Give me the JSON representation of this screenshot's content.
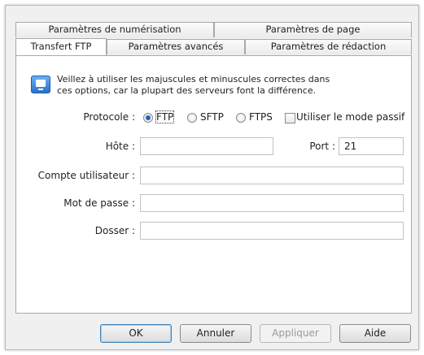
{
  "tabs": {
    "row1": [
      "Paramètres de numérisation",
      "Paramètres de page"
    ],
    "row2": [
      "Transfert FTP",
      "Paramètres avancés",
      "Paramètres de rédaction"
    ]
  },
  "info": {
    "line1": "Veillez à utiliser les majuscules et minuscules correctes dans",
    "line2": "ces options, car la plupart des serveurs font la différence."
  },
  "protocol": {
    "label": "Protocole :",
    "options": [
      "FTP",
      "SFTP",
      "FTPS"
    ],
    "selected": "FTP",
    "passive_label": "Utiliser le mode passif",
    "passive_checked": false
  },
  "host": {
    "label": "Hôte :",
    "value": ""
  },
  "port": {
    "label": "Port :",
    "value": "21"
  },
  "account": {
    "label": "Compte utilisateur :",
    "value": ""
  },
  "password": {
    "label": "Mot de passe :",
    "value": ""
  },
  "folder": {
    "label": "Dosser :",
    "value": ""
  },
  "buttons": {
    "ok": "OK",
    "cancel": "Annuler",
    "apply": "Appliquer",
    "help": "Aide"
  }
}
